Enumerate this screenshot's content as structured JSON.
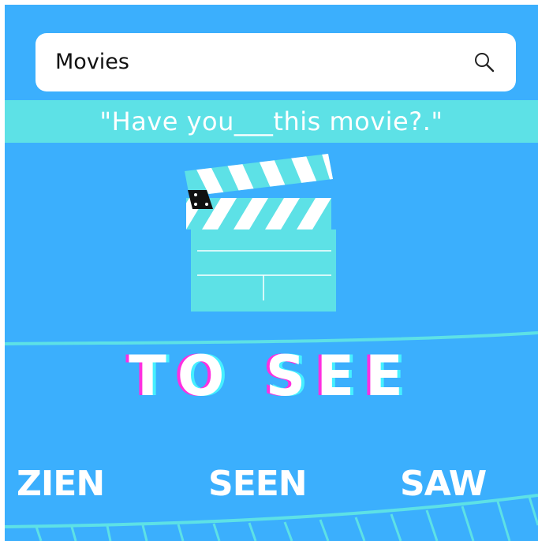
{
  "search": {
    "query": "Movies",
    "icon": "search-icon"
  },
  "prompt": {
    "text": "\"Have you___this movie?.\""
  },
  "title": {
    "text": "TO SEE"
  },
  "answers": [
    {
      "label": "ZIEN"
    },
    {
      "label": "SEEN"
    },
    {
      "label": "SAW"
    }
  ],
  "colors": {
    "background": "#3baffd",
    "band": "#5de1e6",
    "glitch_pink": "#ff2fe0",
    "glitch_cyan": "#46f0ff"
  }
}
